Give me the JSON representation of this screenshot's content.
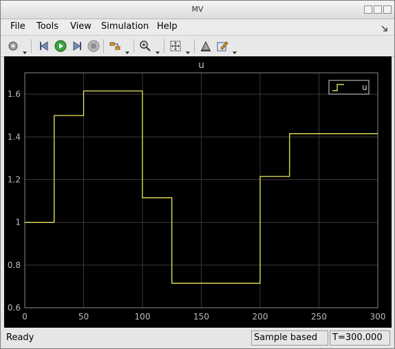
{
  "window": {
    "title": "MV"
  },
  "menu": [
    {
      "label": "File"
    },
    {
      "label": "Tools"
    },
    {
      "label": "View"
    },
    {
      "label": "Simulation"
    },
    {
      "label": "Help"
    }
  ],
  "toolbar": {
    "icons": [
      "settings-icon",
      "step-back-icon",
      "run-icon",
      "step-forward-icon",
      "stop-icon",
      "signal-selector-icon",
      "zoom-in-icon",
      "fit-view-icon",
      "highlight-icon",
      "style-icon"
    ]
  },
  "status": {
    "text": "Ready",
    "sample_mode": "Sample based",
    "time": "T=300.000"
  },
  "colors": {
    "plot_background": "#000000",
    "grid": "#3a3a3a",
    "line": "#ffff66",
    "axis_text": "#bdbdbd"
  },
  "chart_data": {
    "type": "line",
    "title": "u",
    "xlim": [
      0,
      300
    ],
    "ylim": [
      0.6,
      1.7
    ],
    "xticks": [
      0,
      50,
      100,
      150,
      200,
      250,
      300
    ],
    "yticks": [
      0.6,
      0.8,
      1,
      1.2,
      1.4,
      1.6
    ],
    "ytick_labels": [
      "0.6",
      "0.8",
      "1",
      "1.2",
      "1.4",
      "1.6"
    ],
    "grid": true,
    "legend_position": "top-right",
    "series": [
      {
        "name": "u",
        "step": true,
        "x": [
          0,
          25,
          50,
          100,
          125,
          200,
          225,
          300
        ],
        "y": [
          1.0,
          1.5,
          1.615,
          1.115,
          0.715,
          1.215,
          1.415,
          1.415
        ]
      }
    ]
  }
}
